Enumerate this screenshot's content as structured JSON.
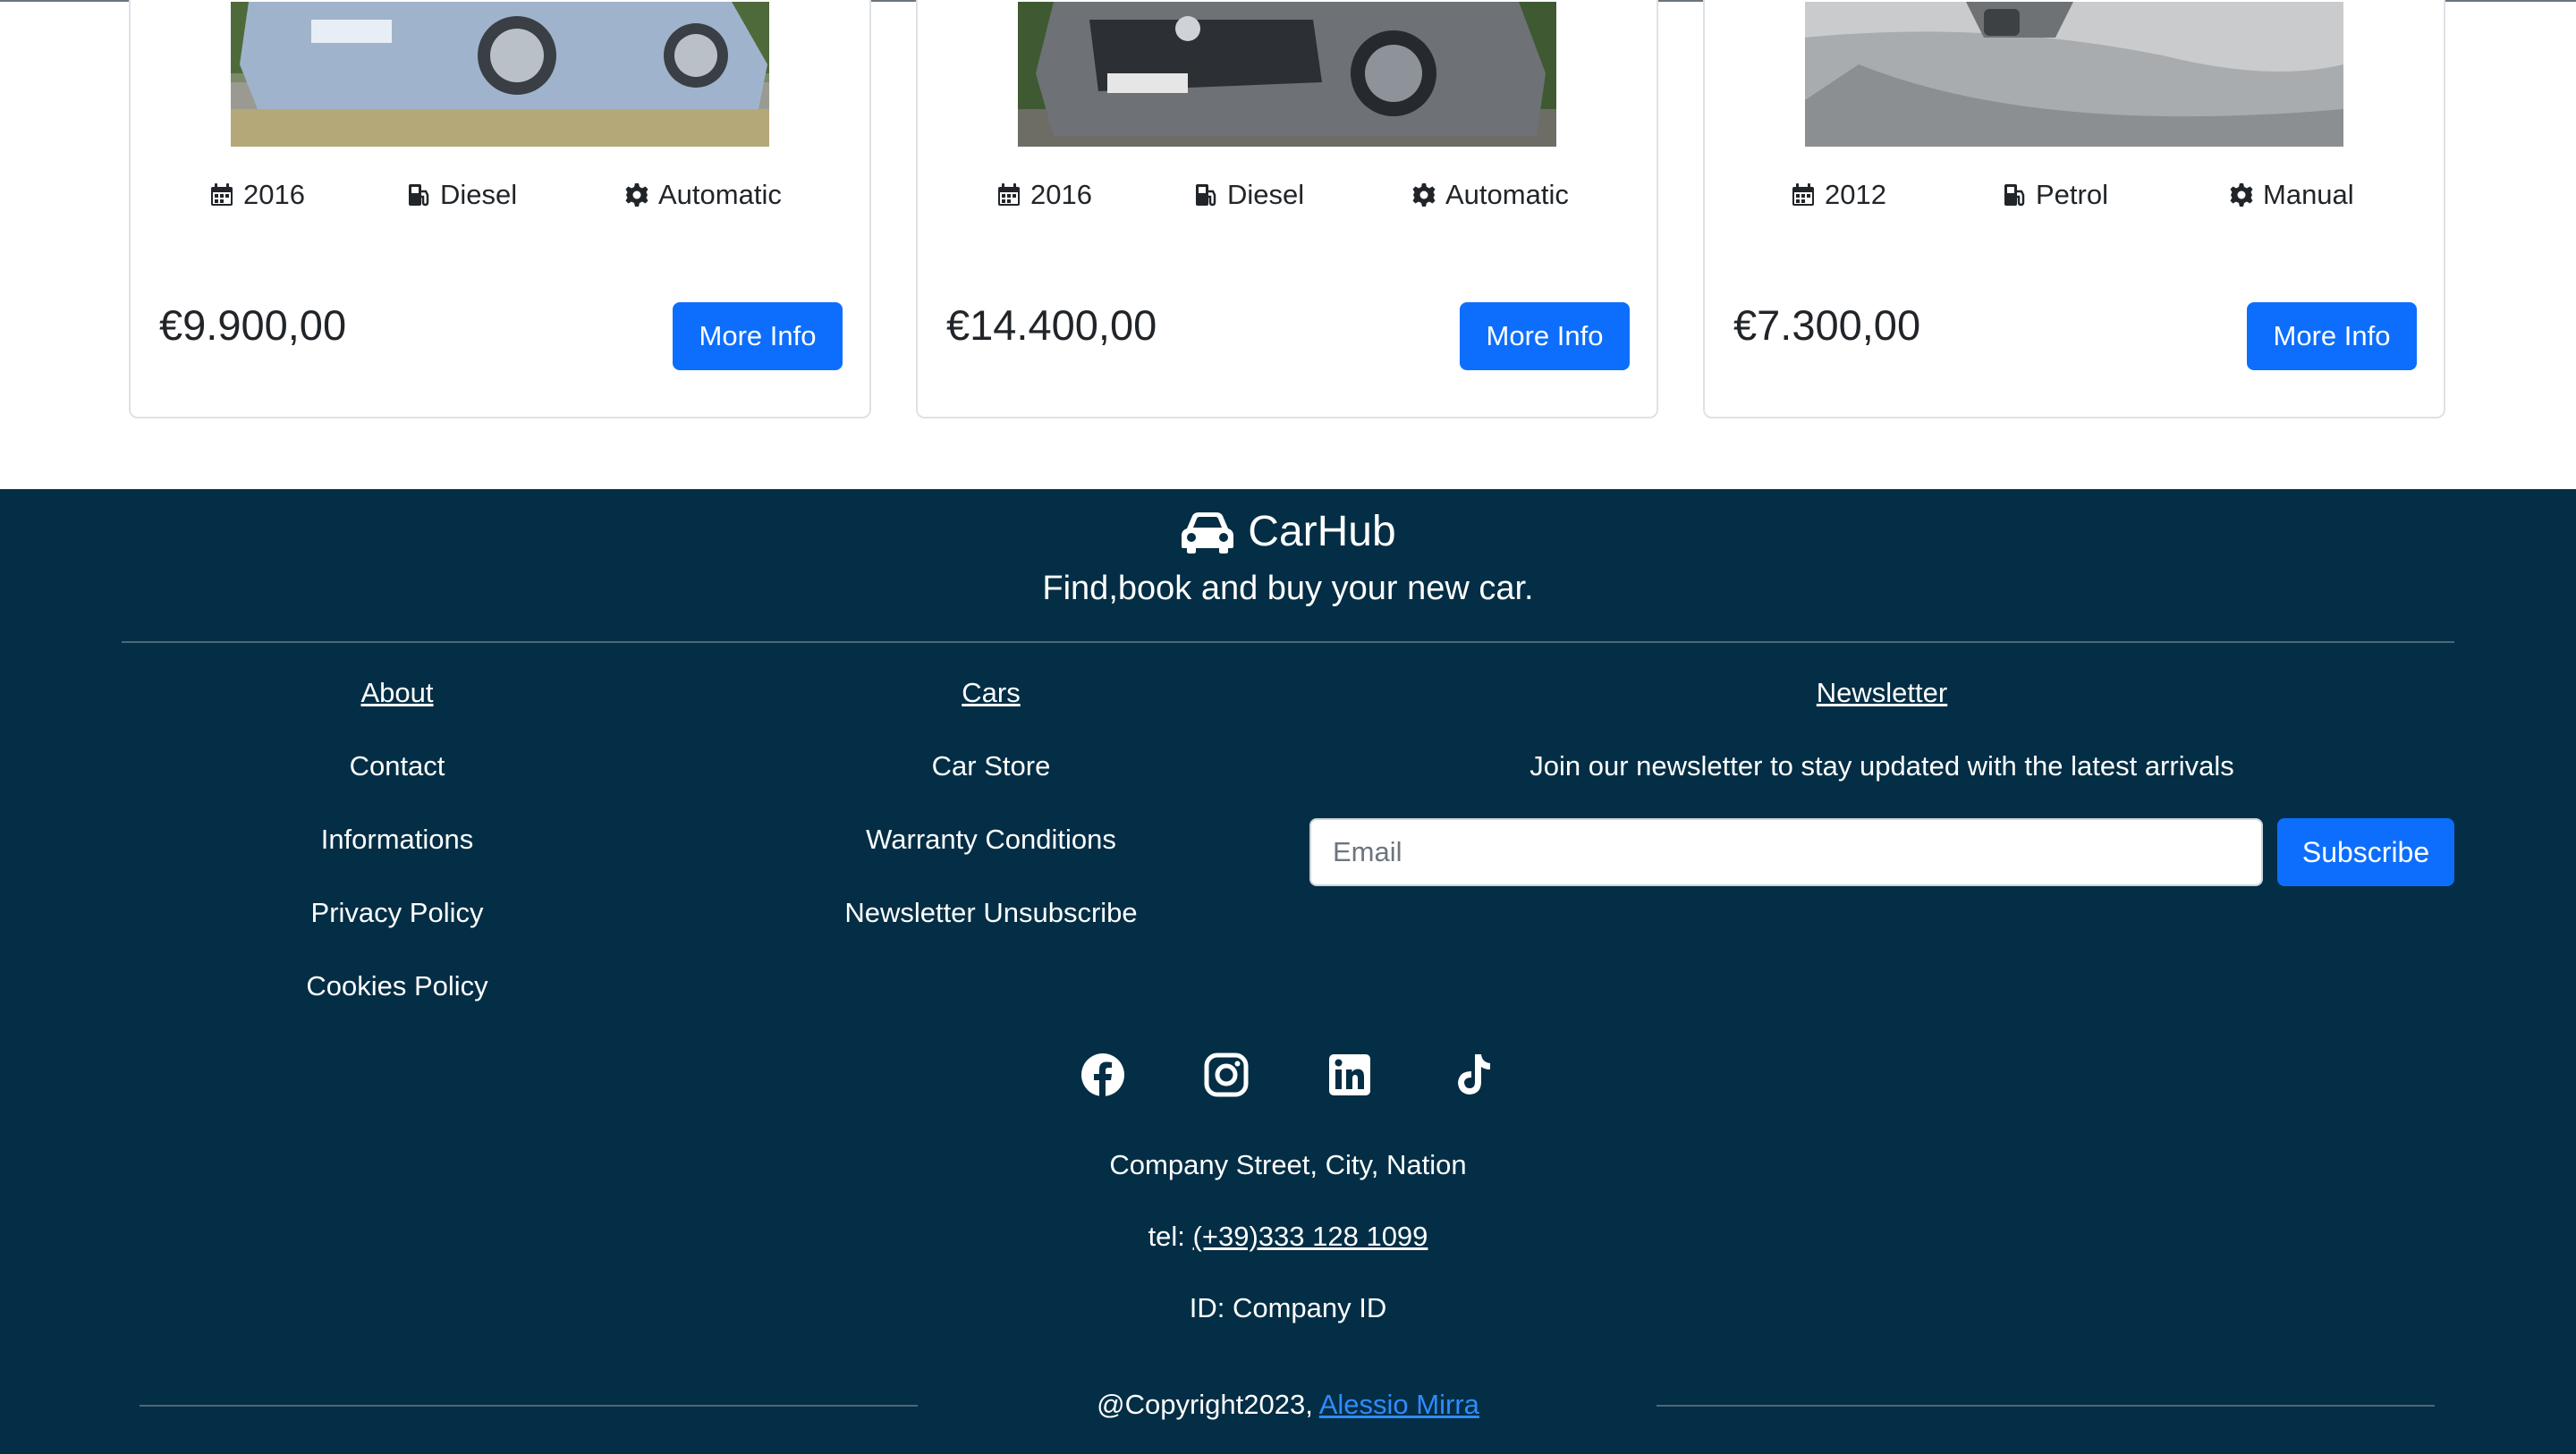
{
  "cards": [
    {
      "year": "2016",
      "fuel": "Diesel",
      "transmission": "Automatic",
      "price": "€9.900,00",
      "button": "More Info"
    },
    {
      "year": "2016",
      "fuel": "Diesel",
      "transmission": "Automatic",
      "price": "€14.400,00",
      "button": "More Info"
    },
    {
      "year": "2012",
      "fuel": "Petrol",
      "transmission": "Manual",
      "price": "€7.300,00",
      "button": "More Info"
    }
  ],
  "footer": {
    "brand": "CarHub",
    "tagline": "Find,book and buy your new car.",
    "about": {
      "heading": "About",
      "items": [
        "Contact",
        "Informations",
        "Privacy Policy",
        "Cookies Policy"
      ]
    },
    "cars": {
      "heading": "Cars",
      "items": [
        "Car Store",
        "Warranty Conditions",
        "Newsletter Unsubscribe"
      ]
    },
    "newsletter": {
      "heading": "Newsletter",
      "text": "Join our newsletter to stay updated with the latest arrivals",
      "placeholder": "Email",
      "button": "Subscribe"
    },
    "social": [
      "facebook-icon",
      "instagram-icon",
      "linkedin-icon",
      "tiktok-icon"
    ],
    "address": "Company Street, City, Nation",
    "tel_label": "tel:",
    "tel": "(+39)333 128 1099",
    "company_id": "ID: Company ID",
    "copyright": "@Copyright2023,",
    "author": "Alessio Mirra"
  },
  "colors": {
    "footer_bg": "#032e45",
    "primary": "#0d6efd",
    "link": "#2f8cff"
  }
}
